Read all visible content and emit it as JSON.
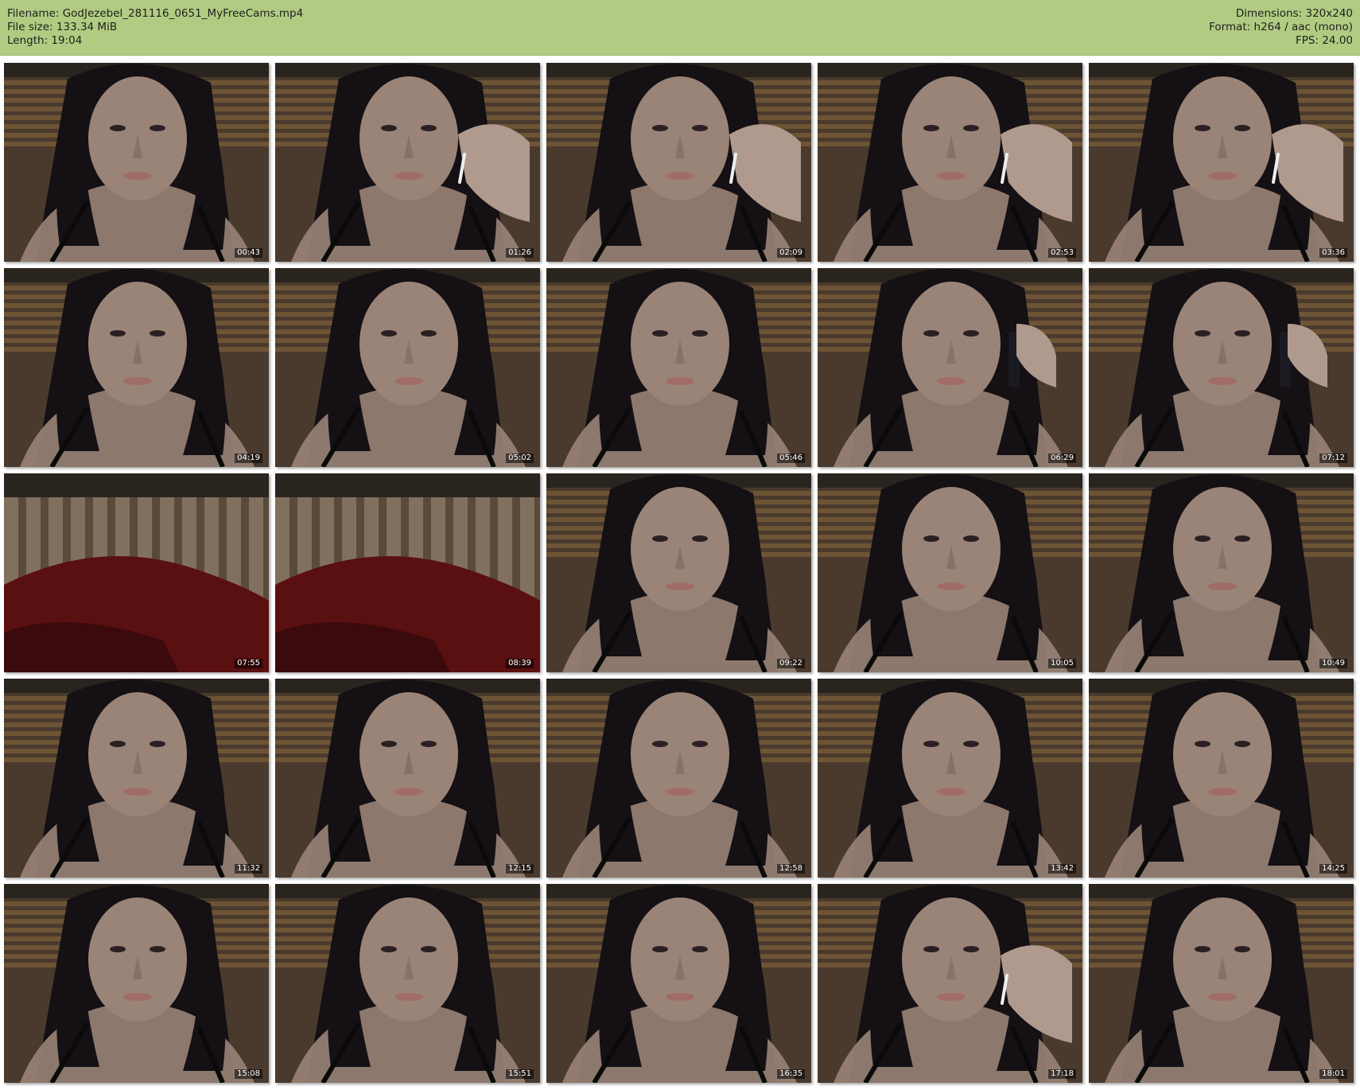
{
  "header": {
    "filename": "Filename: GodJezebel_281116_0651_MyFreeCams.mp4",
    "filesize": "File size: 133.34 MiB",
    "length": "Length: 19:04",
    "dimensions": "Dimensions: 320x240",
    "format": "Format: h264 / aac (mono)",
    "fps": "FPS: 24.00"
  },
  "colors": {
    "header_bg": "#b1cc82",
    "frame_bg": "#4a3a2e",
    "blind": "#8a6a3a",
    "skin": "#9a8478",
    "hair": "#141014",
    "pillow": "#5a0f10"
  },
  "thumbnails": [
    {
      "timestamp": "00:43",
      "scene": "face"
    },
    {
      "timestamp": "01:26",
      "scene": "face-hand"
    },
    {
      "timestamp": "02:09",
      "scene": "face-hand"
    },
    {
      "timestamp": "02:53",
      "scene": "face-hand"
    },
    {
      "timestamp": "03:36",
      "scene": "face-hand"
    },
    {
      "timestamp": "04:19",
      "scene": "face"
    },
    {
      "timestamp": "05:02",
      "scene": "face"
    },
    {
      "timestamp": "05:46",
      "scene": "face"
    },
    {
      "timestamp": "06:29",
      "scene": "face-phone"
    },
    {
      "timestamp": "07:12",
      "scene": "face-phone"
    },
    {
      "timestamp": "07:55",
      "scene": "empty"
    },
    {
      "timestamp": "08:39",
      "scene": "empty"
    },
    {
      "timestamp": "09:22",
      "scene": "face"
    },
    {
      "timestamp": "10:05",
      "scene": "face"
    },
    {
      "timestamp": "10:49",
      "scene": "face"
    },
    {
      "timestamp": "11:32",
      "scene": "face"
    },
    {
      "timestamp": "12:15",
      "scene": "face"
    },
    {
      "timestamp": "12:58",
      "scene": "face"
    },
    {
      "timestamp": "13:42",
      "scene": "face"
    },
    {
      "timestamp": "14:25",
      "scene": "face"
    },
    {
      "timestamp": "15:08",
      "scene": "face"
    },
    {
      "timestamp": "15:51",
      "scene": "face"
    },
    {
      "timestamp": "16:35",
      "scene": "face"
    },
    {
      "timestamp": "17:18",
      "scene": "face-hand"
    },
    {
      "timestamp": "18:01",
      "scene": "face"
    }
  ]
}
